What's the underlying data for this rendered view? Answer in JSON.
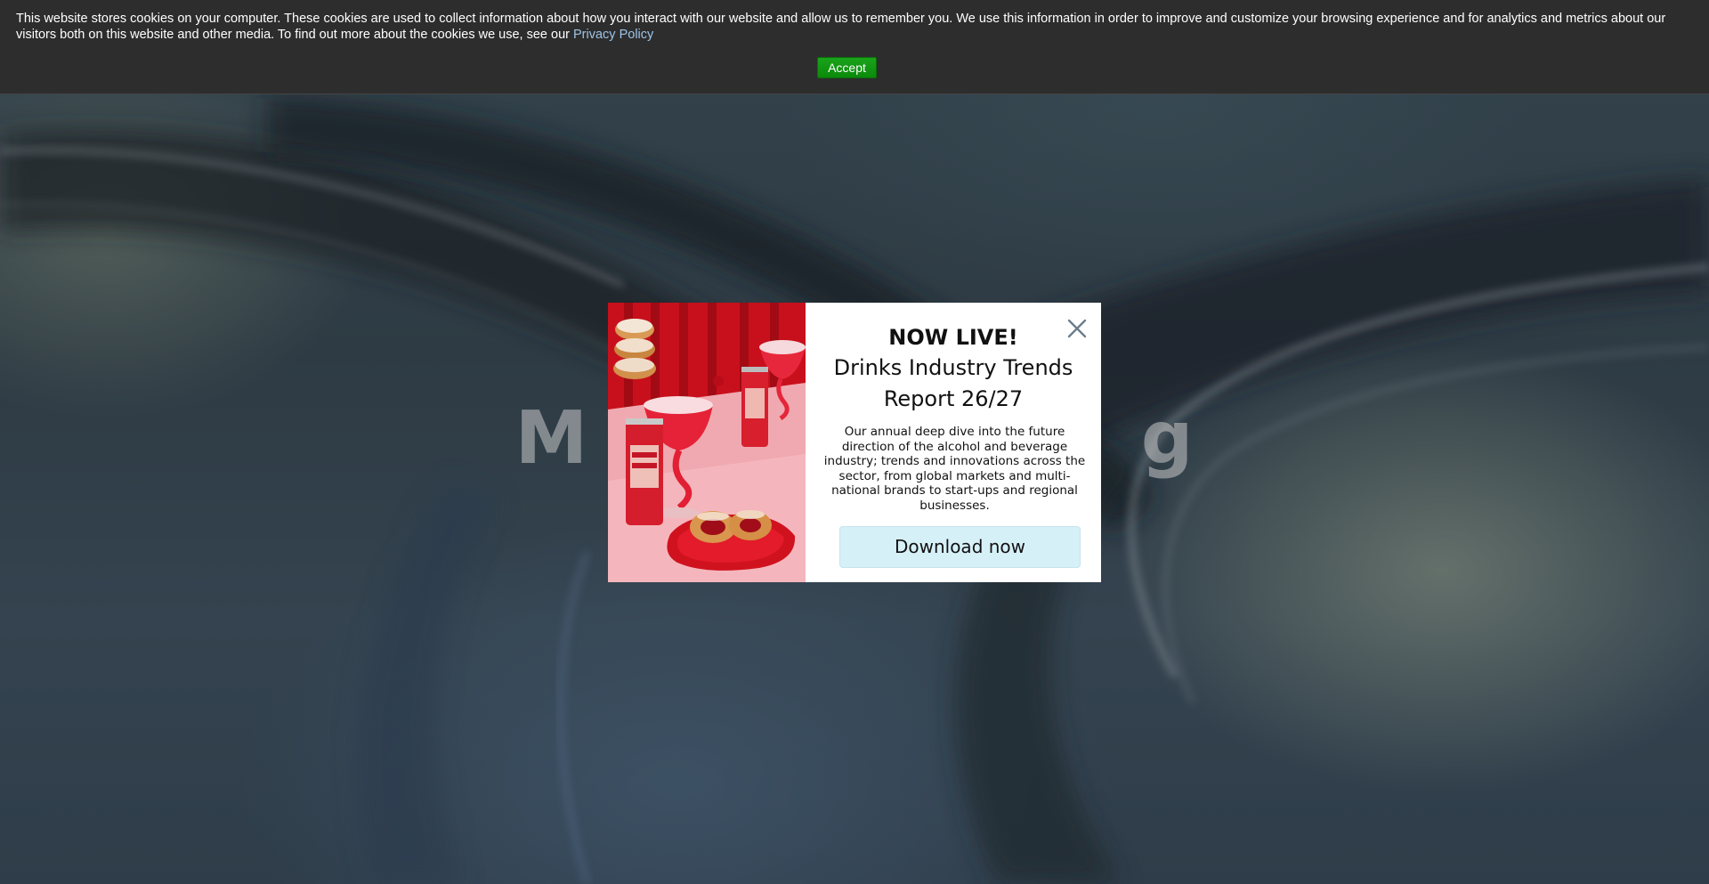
{
  "cookie_banner": {
    "text": "This website stores cookies on your computer. These cookies are used to collect information about how you interact with our website and allow us to remember you. We use this information in order to improve and customize your browsing experience and for analytics and metrics about our visitors both on this website and other media. To find out more about the cookies we use, see our ",
    "link_label": "Privacy Policy",
    "accept_label": "Accept"
  },
  "hero": {
    "title": "M                     g"
  },
  "popup": {
    "headline": "NOW LIVE!",
    "title": "Drinks Industry Trends Report 26/27",
    "description": "Our annual deep dive into the future direction of the alcohol and beverage industry; trends and innovations across the sector, from global markets and multi-national brands to start-ups and regional businesses.",
    "cta_label": "Download now",
    "close_icon": "close-icon"
  }
}
